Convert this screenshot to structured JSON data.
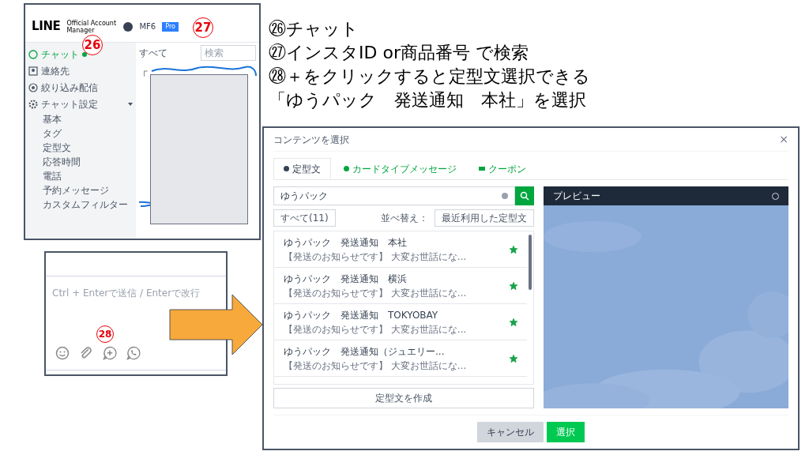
{
  "instructions": [
    "㉖チャット",
    "㉗インスタID or商品番号 で検索",
    "㉘＋をクリックすると定型文選択できる",
    "「ゆうパック　発送通知　本社」を選択"
  ],
  "manager_screenshot": {
    "logo": "LINE",
    "logo_sub": "Official Account Manager",
    "account": "MF6",
    "plan": "Pro",
    "callouts": [
      "26",
      "27"
    ],
    "nav": [
      {
        "label": "チャット",
        "selected": true,
        "kind": "chat"
      },
      {
        "label": "連絡先",
        "selected": false,
        "kind": "contacts"
      },
      {
        "label": "絞り込み配信",
        "selected": false,
        "kind": "broadcast"
      },
      {
        "label": "チャット設定",
        "selected": false,
        "kind": "settings",
        "expanded": true,
        "children": [
          {
            "label": "基本"
          },
          {
            "label": "タグ"
          },
          {
            "label": "定型文"
          },
          {
            "label": "応答時間"
          },
          {
            "label": "電話"
          },
          {
            "label": "予約メッセージ"
          },
          {
            "label": "カスタムフィルター"
          }
        ]
      }
    ],
    "filter": "すべて",
    "search_placeholder": "検索",
    "fragment": "「"
  },
  "composer_screenshot": {
    "placeholder": "Ctrl + Enterで送信 / Enterで改行",
    "callout": "28"
  },
  "dialog": {
    "title": "コンテンツを選択",
    "close": "×",
    "tabs": [
      {
        "label": "定型文",
        "selected": true,
        "kind": "bubble"
      },
      {
        "label": "カードタイプメッセージ",
        "selected": false,
        "kind": "bubble"
      },
      {
        "label": "クーポン",
        "selected": false,
        "kind": "ticket"
      }
    ],
    "search_value": "ゆうパック",
    "filter": "すべて(11)",
    "sort_label": "並べ替え：",
    "sort": "最近利用した定型文",
    "items": [
      {
        "title": "ゆうパック　発送通知　本社",
        "preview": "【発送のお知らせです】 大変お世話にな...",
        "starred": true
      },
      {
        "title": "ゆうパック　発送通知　横浜",
        "preview": "【発送のお知らせです】 大変お世話にな...",
        "starred": true
      },
      {
        "title": "ゆうパック　発送通知　TOKYOBAY",
        "preview": "【発送のお知らせです】 大変お世話にな...",
        "starred": true
      },
      {
        "title": "ゆうパック　発送通知（ジュエリー...",
        "preview": "【発送のお知らせです】 大変お世話にな...",
        "starred": true
      }
    ],
    "create_button": "定型文を作成",
    "preview_title": "プレビュー",
    "cancel": "キャンセル",
    "ok": "選択"
  }
}
